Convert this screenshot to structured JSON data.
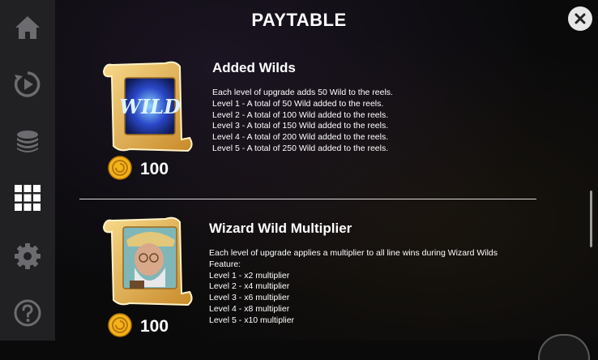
{
  "header": {
    "title": "PAYTABLE"
  },
  "colors": {
    "sidebar": "#212124",
    "sidebar_icon": "#6c6c70",
    "gold": "#e9b84a",
    "coin": "#f4b319",
    "background": "#0a0a0b"
  },
  "sidebar": {
    "items": [
      {
        "icon": "home-icon"
      },
      {
        "icon": "replay-icon"
      },
      {
        "icon": "chips-icon"
      },
      {
        "icon": "paytable-grid-icon",
        "active": true
      },
      {
        "icon": "gear-icon"
      },
      {
        "icon": "help-icon"
      }
    ]
  },
  "close": {
    "icon": "close-icon"
  },
  "features": [
    {
      "title": "Added Wilds",
      "art_text": "WILD",
      "price": "100",
      "description": "Each level of upgrade adds 50 Wild to the reels.\nLevel 1 - A total of 50 Wild added to the reels.\nLevel 2 - A total of 100 Wild added to the reels.\nLevel 3 - A total of 150 Wild added to the reels.\nLevel 4 - A total of 200 Wild added to the reels.\nLevel 5 - A total of 250 Wild added to the reels."
    },
    {
      "title": "Wizard Wild Multiplier",
      "price": "100",
      "description": "Each level of upgrade applies a multiplier to all line wins during Wizard Wilds\nFeature:\nLevel 1 - x2 multiplier\nLevel 2 - x4 multiplier\nLevel 3 - x6 multiplier\nLevel 4 - x8 multiplier\nLevel 5 - x10 multiplier"
    }
  ]
}
